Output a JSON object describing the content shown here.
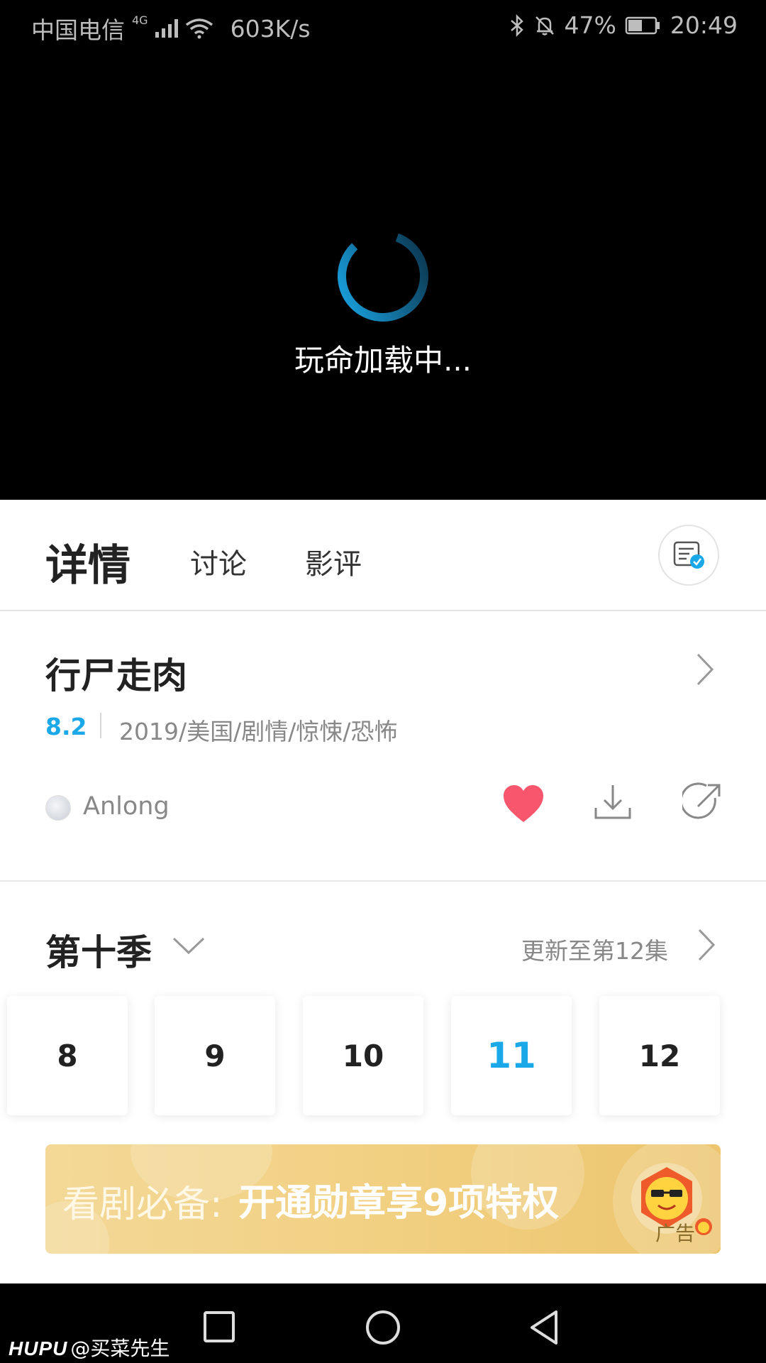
{
  "status_bar": {
    "carrier": "中国电信",
    "network": "4G",
    "speed": "603K/s",
    "battery": "47%",
    "time": "20:49"
  },
  "player": {
    "loading_text": "玩命加载中..."
  },
  "tabs": {
    "active": "详情",
    "discuss": "讨论",
    "review": "影评"
  },
  "show": {
    "title": "行尸走肉",
    "score": "8.2",
    "meta": "2019/美国/剧情/惊悚/恐怖",
    "uploader": "Anlong"
  },
  "season": {
    "label": "第十季",
    "update_text": "更新至第12集",
    "episodes": [
      "8",
      "9",
      "10",
      "11",
      "12"
    ],
    "active_episode": "11"
  },
  "ad": {
    "text_light": "看剧必备:",
    "text_bold": "开通勋章享9项特权",
    "label": "广告"
  },
  "watermark": {
    "brand": "HUPU",
    "user": "@买菜先生"
  },
  "colors": {
    "accent": "#1aa8e8",
    "heart": "#f7566c",
    "ad_bg": "#f2d184"
  },
  "icons": [
    "bluetooth-icon",
    "mute-bell-icon",
    "battery-icon",
    "wifi-icon",
    "note-icon",
    "chevron-right-icon",
    "heart-icon",
    "download-icon",
    "share-icon",
    "chevron-down-icon",
    "nav-back-icon",
    "nav-home-icon",
    "nav-recent-icon"
  ]
}
